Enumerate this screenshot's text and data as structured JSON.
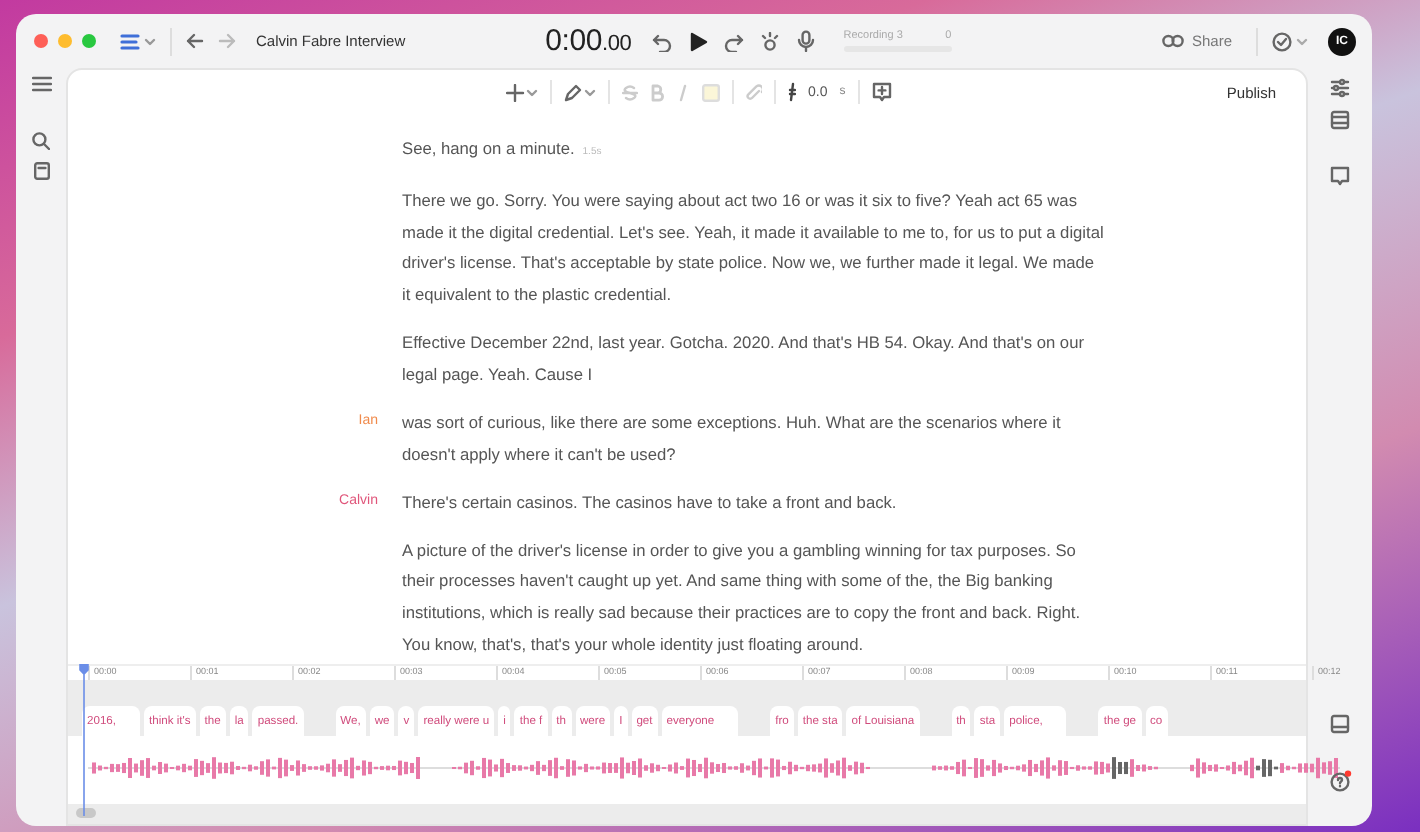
{
  "window": {
    "title": "Calvin Fabre Interview"
  },
  "player": {
    "time_main": "0:00",
    "time_fraction": ".00",
    "recording": {
      "name": "Recording 3",
      "count": "0",
      "level": 0.0
    }
  },
  "share": {
    "label": "Share"
  },
  "avatar": {
    "initials": "IC"
  },
  "toolbar": {
    "gap_value": "0.0",
    "gap_unit": "s",
    "publish": "Publish"
  },
  "transcript": [
    {
      "text": "See, hang on a minute.",
      "pause": "1.5s"
    },
    {
      "text": "There we go. Sorry. You were saying about act two 16 or was it six to five? Yeah act 65 was made it the digital credential. Let's see. Yeah, it made it available to me to, for us to put a digital driver's license. That's acceptable by state police. Now we, we further made it legal. We made it equivalent to the plastic credential."
    },
    {
      "text": "Effective December 22nd, last year. Gotcha. 2020. And that's HB 54. Okay. And that's on our legal page. Yeah. Cause I"
    },
    {
      "speaker": "Ian",
      "color": "#f08a4b",
      "text": "was sort of curious, like there are some exceptions. Huh. What are the scenarios where it doesn't apply where it can't be used?"
    },
    {
      "speaker": "Calvin",
      "color": "#e0557a",
      "text": "There's certain casinos. The casinos have to take a front and back."
    },
    {
      "text": "A picture of the driver's license in order to give you a gambling winning for tax purposes. So their processes haven't caught up yet. And same thing with some of the, the Big banking institutions, which is really sad because their practices are to copy the front and back. Right. You know, that's, that's your whole identity just floating around."
    }
  ],
  "timeline": {
    "ruler": [
      "00:00",
      "00:01",
      "00:02",
      "00:03",
      "00:04",
      "00:05",
      "00:06",
      "00:07",
      "00:08",
      "00:09",
      "00:10",
      "00:11",
      "00:12"
    ],
    "words": [
      {
        "text": "2016,",
        "kind": "wide"
      },
      {
        "text": "think it's",
        "kind": "word"
      },
      {
        "text": "the",
        "kind": "word"
      },
      {
        "text": "la",
        "kind": "word"
      },
      {
        "text": "passed.",
        "kind": "word"
      },
      {
        "text": "We,",
        "kind": "after-gap"
      },
      {
        "text": "we",
        "kind": "word"
      },
      {
        "text": "v",
        "kind": "word"
      },
      {
        "text": "really were u",
        "kind": "word"
      },
      {
        "text": "i",
        "kind": "word"
      },
      {
        "text": "the f",
        "kind": "word"
      },
      {
        "text": "th",
        "kind": "word"
      },
      {
        "text": "were",
        "kind": "word"
      },
      {
        "text": "I",
        "kind": "word"
      },
      {
        "text": "get",
        "kind": "word"
      },
      {
        "text": "everyone",
        "kind": "wide"
      },
      {
        "text": "fro",
        "kind": "after-gap"
      },
      {
        "text": "the sta",
        "kind": "word"
      },
      {
        "text": "of Louisiana",
        "kind": "word"
      },
      {
        "text": "th",
        "kind": "after-gap"
      },
      {
        "text": "sta",
        "kind": "word"
      },
      {
        "text": "police,",
        "kind": "wide"
      },
      {
        "text": "the ge",
        "kind": "after-gap"
      },
      {
        "text": "co",
        "kind": "word"
      }
    ]
  }
}
